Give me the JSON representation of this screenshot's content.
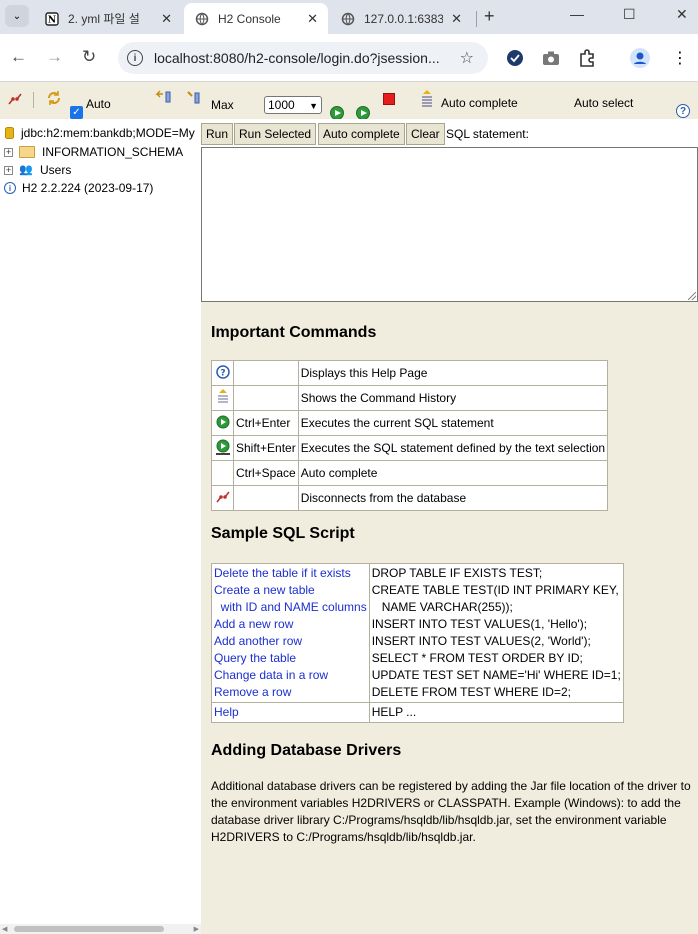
{
  "browser": {
    "tabs": [
      {
        "title": "2. yml 파일 설",
        "favicon": "notion-icon"
      },
      {
        "title": "H2 Console",
        "favicon": "globe-icon"
      },
      {
        "title": "127.0.0.1:6383",
        "favicon": "globe-icon"
      }
    ],
    "url": "localhost:8080/h2-console/login.do?jsession..."
  },
  "toolbar": {
    "auto_commit_label": "Auto",
    "auto_commit_checked": true,
    "max_label": "Max",
    "max_rows_value": "1000",
    "auto_complete_label": "Auto complete",
    "auto_select_label": "Auto select"
  },
  "tree": {
    "connection": "jdbc:h2:mem:bankdb;MODE=My",
    "nodes": [
      "INFORMATION_SCHEMA",
      "Users"
    ],
    "version": "H2 2.2.224 (2023-09-17)"
  },
  "query": {
    "buttons": [
      "Run",
      "Run Selected",
      "Auto complete",
      "Clear"
    ],
    "label": "SQL statement:"
  },
  "help": {
    "important_title": "Important Commands",
    "commands": [
      {
        "icon": "help-icon",
        "key": "",
        "desc": "Displays this Help Page"
      },
      {
        "icon": "history-icon",
        "key": "",
        "desc": "Shows the Command History"
      },
      {
        "icon": "run-icon",
        "key": "Ctrl+Enter",
        "desc": "Executes the current SQL statement"
      },
      {
        "icon": "run-selected-icon",
        "key": "Shift+Enter",
        "desc": "Executes the SQL statement defined by the text selection"
      },
      {
        "icon": "",
        "key": "Ctrl+Space",
        "desc": "Auto complete"
      },
      {
        "icon": "disconnect-icon",
        "key": "",
        "desc": "Disconnects from the database"
      }
    ],
    "sample_title": "Sample SQL Script",
    "sample_links": [
      "Delete the table if it exists",
      "Create a new table",
      "  with ID and NAME columns",
      "Add a new row",
      "Add another row",
      "Query the table",
      "Change data in a row",
      "Remove a row"
    ],
    "sample_code": [
      "DROP TABLE IF EXISTS TEST;",
      "CREATE TABLE TEST(ID INT PRIMARY KEY,",
      "   NAME VARCHAR(255));",
      "INSERT INTO TEST VALUES(1, 'Hello');",
      "INSERT INTO TEST VALUES(2, 'World');",
      "SELECT * FROM TEST ORDER BY ID;",
      "UPDATE TEST SET NAME='Hi' WHERE ID=1;",
      "DELETE FROM TEST WHERE ID=2;"
    ],
    "help_link": "Help",
    "help_code": "HELP ...",
    "drivers_title": "Adding Database Drivers",
    "drivers_text": "Additional database drivers can be registered by adding the Jar file location of the driver to the environment variables H2DRIVERS or CLASSPATH. Example (Windows): to add the database driver library C:/Programs/hsqldb/lib/hsqldb.jar, set the environment variable H2DRIVERS to C:/Programs/hsqldb/lib/hsqldb.jar."
  }
}
